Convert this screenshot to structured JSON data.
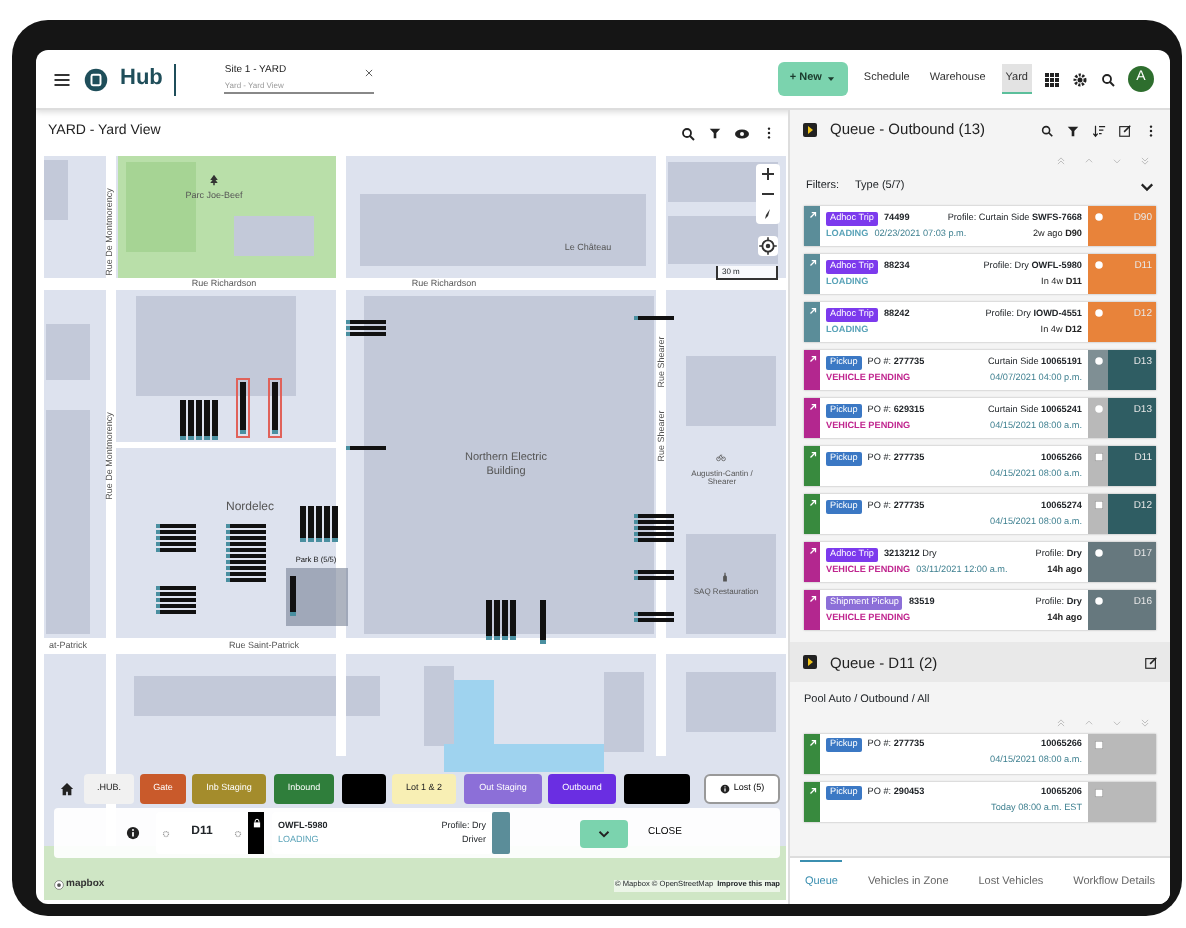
{
  "header": {
    "logo_text": "Hub",
    "site_field": {
      "value": "Site 1 - YARD",
      "caption": "Yard - Yard View"
    },
    "new_button": "+ New",
    "nav": [
      {
        "label": "Schedule",
        "selected": false
      },
      {
        "label": "Warehouse",
        "selected": false
      },
      {
        "label": "Yard",
        "selected": true
      }
    ],
    "avatar": "A"
  },
  "yard_panel": {
    "title": "YARD - Yard View",
    "map": {
      "park": "Parc Joe-Beef",
      "landmark": "Le Château",
      "streets": [
        "Rue Richardson",
        "Rue Richardson",
        "at-Patrick",
        "Rue Saint-Patrick"
      ],
      "vertical_streets": [
        "Rue De Montmorency",
        "Rue De Montmorency",
        "Rue Shearer",
        "Rue Shearer"
      ],
      "building": "Northern Electric Building",
      "area": "Nordelec",
      "stop": "Augustin-Cantin / Shearer",
      "shop": "SAQ Restauration",
      "parking": "Park B (5/5)",
      "scale": "30 m",
      "logo": "mapbox",
      "attribution": "© Mapbox © OpenStreetMap",
      "improve_link": "Improve this map"
    },
    "zones": [
      {
        "label": ".HUB.",
        "color": "#f1f1f1"
      },
      {
        "label": "Gate",
        "color": "#c95a2b"
      },
      {
        "label": "Inb Staging",
        "color": "#a48c2c"
      },
      {
        "label": "Inbound",
        "color": "#2f7e3b"
      },
      {
        "color": "#000000"
      },
      {
        "label": "Lot 1 & 2",
        "color": "#f8efb4"
      },
      {
        "label": "Out Staging",
        "color": "#8c6fd8"
      },
      {
        "label": "Outbound",
        "color": "#6a2ee2"
      },
      {
        "color": "#000000"
      }
    ],
    "lost_button": "Lost (5)",
    "detail": {
      "door": "D11",
      "vehicle": "OWFL-5980",
      "status": "LOADING",
      "profile": "Profile: Dry",
      "driver": "Driver",
      "close": "CLOSE"
    }
  },
  "queue": {
    "title": "Queue - Outbound (13)",
    "filters_label": "Filters:",
    "filter_value": "Type (5/7)",
    "cards": [
      {
        "color": "#5b8d99",
        "badge": {
          "label": "Adhoc Trip",
          "color": "#7c3aed"
        },
        "ref": "**74499**",
        "status": {
          "label": "LOADING",
          "color": "#5aa3b8"
        },
        "date": "02/23/2021 07:03 p.m.",
        "top_right": "Profile: Curtain Side **SWFS-7668**",
        "bottom_right": "2w ago **D90**",
        "marker": {
          "kind": "dot",
          "color": "#e8833a"
        },
        "door": {
          "label": "D90",
          "color": "#e8833a"
        }
      },
      {
        "color": "#5b8d99",
        "badge": {
          "label": "Adhoc Trip",
          "color": "#7c3aed"
        },
        "ref": "**88234**",
        "status": {
          "label": "LOADING",
          "color": "#5aa3b8"
        },
        "top_right": "Profile: Dry **OWFL-5980**",
        "bottom_right": "In 4w **D11**",
        "marker": {
          "kind": "dot",
          "color": "#e8833a"
        },
        "door": {
          "label": "D11",
          "color": "#e8833a"
        }
      },
      {
        "color": "#5b8d99",
        "badge": {
          "label": "Adhoc Trip",
          "color": "#7c3aed"
        },
        "ref": "**88242**",
        "status": {
          "label": "LOADING",
          "color": "#5aa3b8"
        },
        "top_right": "Profile: Dry **IOWD-4551**",
        "bottom_right": "In 4w **D12**",
        "marker": {
          "kind": "dot",
          "color": "#e8833a"
        },
        "door": {
          "label": "D12",
          "color": "#e8833a"
        }
      },
      {
        "color": "#b3278f",
        "badge": {
          "label": "Pickup",
          "color": "#3b78c4"
        },
        "ref": "PO #: **277735**",
        "status": {
          "label": "VEHICLE PENDING",
          "color": "#c0268f"
        },
        "top_right": "Curtain Side **10065191**",
        "bottom_right": "04/07/2021 04:00 p.m.",
        "marker": {
          "kind": "dot",
          "color": "#7f8f94"
        },
        "door": {
          "label": "D13",
          "color": "#2f5d63"
        }
      },
      {
        "color": "#b3278f",
        "badge": {
          "label": "Pickup",
          "color": "#3b78c4"
        },
        "ref": "PO #: **629315**",
        "status": {
          "label": "VEHICLE PENDING",
          "color": "#c0268f"
        },
        "top_right": "Curtain Side **10065241**",
        "bottom_right": "04/15/2021 08:00 a.m.",
        "marker": {
          "kind": "dot",
          "color": "#b9b9b9"
        },
        "door": {
          "label": "D13",
          "color": "#2f5d63"
        }
      },
      {
        "color": "#388a3e",
        "badge": {
          "label": "Pickup",
          "color": "#3b78c4"
        },
        "ref": "PO #: **277735**",
        "top_right": "**10065266**",
        "bottom_right": "04/15/2021 08:00 a.m.",
        "marker": {
          "kind": "checkbox",
          "color": "#b9b9b9"
        },
        "door": {
          "label": "D11",
          "color": "#2f5d63"
        }
      },
      {
        "color": "#388a3e",
        "badge": {
          "label": "Pickup",
          "color": "#3b78c4"
        },
        "ref": "PO #: **277735**",
        "top_right": "**10065274**",
        "bottom_right": "04/15/2021 08:00 a.m.",
        "marker": {
          "kind": "checkbox",
          "color": "#b9b9b9"
        },
        "door": {
          "label": "D12",
          "color": "#2f5d63"
        }
      },
      {
        "color": "#b3278f",
        "badge": {
          "label": "Adhoc Trip",
          "color": "#7c3aed"
        },
        "ref": "**3213212** Dry",
        "status": {
          "label": "VEHICLE PENDING",
          "color": "#c0268f"
        },
        "date": "03/11/2021 12:00 a.m.",
        "top_right": "Profile: **Dry**",
        "bottom_right": "**14h ago**",
        "marker": {
          "kind": "dot",
          "color": "#66787e"
        },
        "door": {
          "label": "D17",
          "color": "#66787e"
        }
      },
      {
        "color": "#b3278f",
        "badge": {
          "label": "Shipment Pickup",
          "color": "#8c6fd8"
        },
        "ref": "**83519**",
        "status": {
          "label": "VEHICLE PENDING",
          "color": "#c0268f"
        },
        "top_right": "Profile: **Dry**",
        "bottom_right": "**14h ago**",
        "marker": {
          "kind": "dot",
          "color": "#66787e"
        },
        "door": {
          "label": "D16",
          "color": "#66787e"
        }
      }
    ]
  },
  "door_queue": {
    "title": "Queue - D11 (2)",
    "path": "Pool Auto / Outbound / All",
    "cards": [
      {
        "color": "#388a3e",
        "badge": {
          "label": "Pickup",
          "color": "#3b78c4"
        },
        "ref": "PO #: **277735**",
        "top_right": "**10065266**",
        "bottom_right": "04/15/2021 08:00 a.m.",
        "marker": {
          "kind": "checkbox",
          "color": "#b9b9b9"
        },
        "door": {
          "color": "#b9b9b9"
        }
      },
      {
        "color": "#388a3e",
        "badge": {
          "label": "Pickup",
          "color": "#3b78c4"
        },
        "ref": "PO #: **290453**",
        "top_right": "**10065206**",
        "bottom_right": "Today 08:00 a.m. EST",
        "marker": {
          "kind": "checkbox",
          "color": "#b9b9b9"
        },
        "door": {
          "color": "#b9b9b9"
        }
      }
    ]
  },
  "tabs": [
    {
      "label": "Queue",
      "selected": true
    },
    {
      "label": "Vehicles in Zone",
      "selected": false
    },
    {
      "label": "Lost Vehicles",
      "selected": false
    },
    {
      "label": "Workflow Details",
      "selected": false
    }
  ]
}
